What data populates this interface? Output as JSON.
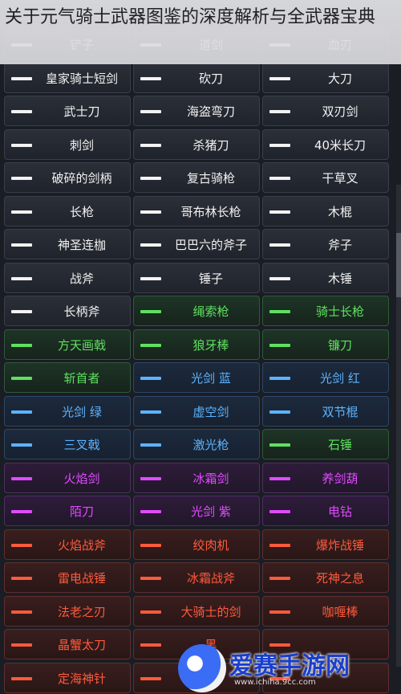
{
  "article": {
    "title": "关于元气骑士武器图鉴的深度解析与全武器宝典"
  },
  "rows": [
    {
      "tier": "white",
      "items": [
        "铲子",
        "道剑",
        "血刃"
      ]
    },
    {
      "tier": "white",
      "items": [
        "皇家骑士短剑",
        "砍刀",
        "大刀"
      ]
    },
    {
      "tier": "white",
      "items": [
        "武士刀",
        "海盗弯刀",
        "双刃剑"
      ]
    },
    {
      "tier": "white",
      "items": [
        "刺剑",
        "杀猪刀",
        "40米长刀"
      ]
    },
    {
      "tier": "white",
      "items": [
        "破碎的剑柄",
        "复古骑枪",
        "干草叉"
      ]
    },
    {
      "tier": "white",
      "items": [
        "长枪",
        "哥布林长枪",
        "木棍"
      ]
    },
    {
      "tier": "white",
      "items": [
        "神圣连枷",
        "巴巴六的斧子",
        "斧子"
      ]
    },
    {
      "tier": "white",
      "items": [
        "战斧",
        "锤子",
        "木锤"
      ]
    },
    {
      "tier": "mixed",
      "items": [
        "长柄斧",
        "绳索枪",
        "骑士长枪"
      ],
      "colors": [
        "white",
        "green",
        "green"
      ]
    },
    {
      "tier": "green",
      "items": [
        "方天画戟",
        "狼牙棒",
        "镰刀"
      ]
    },
    {
      "tier": "mixed",
      "items": [
        "斩首者",
        "光剑 蓝",
        "光剑 红"
      ],
      "colors": [
        "green",
        "blue",
        "blue"
      ]
    },
    {
      "tier": "blue",
      "items": [
        "光剑 绿",
        "虚空剑",
        "双节棍"
      ]
    },
    {
      "tier": "mixed",
      "items": [
        "三叉戟",
        "激光枪",
        "石锤"
      ],
      "colors": [
        "blue",
        "blue",
        "green"
      ]
    },
    {
      "tier": "purple",
      "items": [
        "火焰剑",
        "冰霜剑",
        "养剑葫"
      ]
    },
    {
      "tier": "purple",
      "items": [
        "陌刀",
        "光剑 紫",
        "电钻"
      ]
    },
    {
      "tier": "orange",
      "items": [
        "火焰战斧",
        "绞肉机",
        "爆炸战锤"
      ]
    },
    {
      "tier": "orange",
      "items": [
        "雷电战锤",
        "冰霜战斧",
        "死神之息"
      ]
    },
    {
      "tier": "orange",
      "items": [
        "法老之刃",
        "大骑士的剑",
        "咖喱棒"
      ]
    },
    {
      "tier": "orange",
      "items": [
        "晶蟹太刀",
        "黑",
        ""
      ]
    },
    {
      "tier": "orange",
      "items": [
        "定海神针",
        "",
        ""
      ]
    }
  ],
  "watermark": {
    "text": "爱赛手游网",
    "url": "www.ichiha.9cc.com"
  },
  "colors": {
    "white": "#f2f2f2",
    "green": "#5fe05f",
    "blue": "#5cb3ff",
    "purple": "#e04bff",
    "orange": "#ff5a3c"
  }
}
